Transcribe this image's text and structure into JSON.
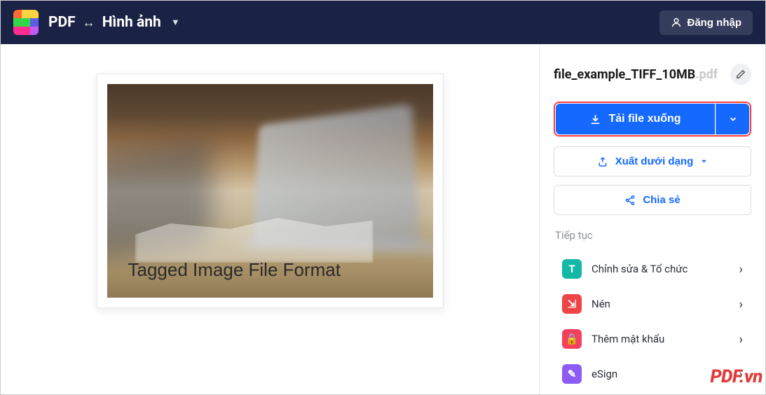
{
  "header": {
    "title_pdf": "PDF",
    "title_arrows_glyph": "↔",
    "title_image": "Hình ảnh",
    "login_label": "Đăng nhập"
  },
  "preview": {
    "caption": "Tagged Image File Format"
  },
  "file": {
    "name": "file_example_TIFF_10MB",
    "ext": ".pdf"
  },
  "actions": {
    "download_label": "Tải file xuống",
    "export_label": "Xuất dưới dạng",
    "share_label": "Chia sẻ"
  },
  "continue": {
    "heading": "Tiếp tục",
    "items": [
      {
        "label": "Chỉnh sửa & Tổ chức",
        "icon_glyph": "T",
        "icon_color": "ic-teal",
        "icon_name": "edit-text-icon"
      },
      {
        "label": "Nén",
        "icon_glyph": "⇲",
        "icon_color": "ic-red",
        "icon_name": "compress-icon"
      },
      {
        "label": "Thêm mật khẩu",
        "icon_glyph": "🔒",
        "icon_color": "ic-rose",
        "icon_name": "lock-icon"
      },
      {
        "label": "eSign",
        "icon_glyph": "✎",
        "icon_color": "ic-purple",
        "icon_name": "esign-icon"
      }
    ]
  },
  "watermark": "PDF.vn"
}
